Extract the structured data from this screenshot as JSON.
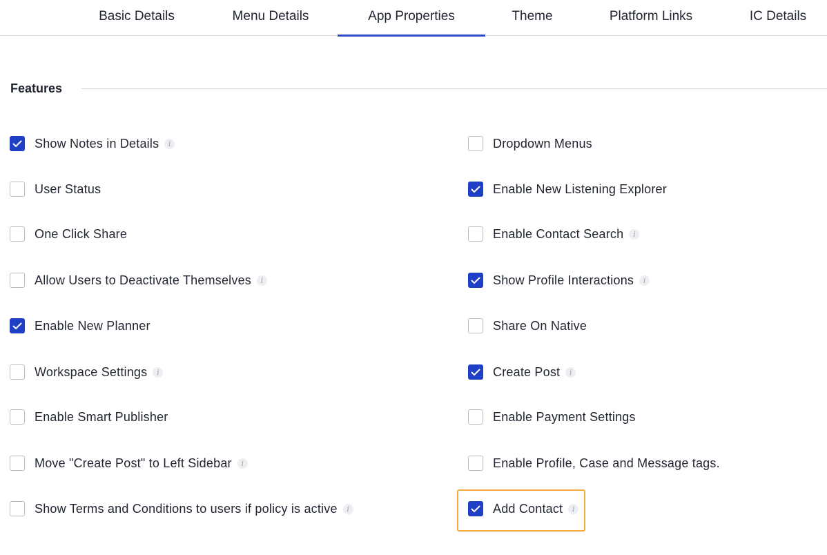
{
  "tabs": [
    {
      "label": "Basic Details",
      "active": false
    },
    {
      "label": "Menu Details",
      "active": false
    },
    {
      "label": "App Properties",
      "active": true
    },
    {
      "label": "Theme",
      "active": false
    },
    {
      "label": "Platform Links",
      "active": false
    },
    {
      "label": "IC Details",
      "active": false
    }
  ],
  "section": {
    "title": "Features"
  },
  "features_left": [
    {
      "label": "Show Notes in Details",
      "checked": true,
      "info": true
    },
    {
      "label": "User Status",
      "checked": false,
      "info": false
    },
    {
      "label": "One Click Share",
      "checked": false,
      "info": false
    },
    {
      "label": "Allow Users to Deactivate Themselves",
      "checked": false,
      "info": true
    },
    {
      "label": "Enable New Planner",
      "checked": true,
      "info": false
    },
    {
      "label": "Workspace Settings",
      "checked": false,
      "info": true
    },
    {
      "label": "Enable Smart Publisher",
      "checked": false,
      "info": false
    },
    {
      "label": "Move \"Create Post\" to Left Sidebar",
      "checked": false,
      "info": true
    },
    {
      "label": "Show Terms and Conditions to users if policy is active",
      "checked": false,
      "info": true
    }
  ],
  "features_right": [
    {
      "label": "Dropdown Menus",
      "checked": false,
      "info": false
    },
    {
      "label": "Enable New Listening Explorer",
      "checked": true,
      "info": false
    },
    {
      "label": "Enable Contact Search",
      "checked": false,
      "info": true
    },
    {
      "label": "Show Profile Interactions",
      "checked": true,
      "info": true
    },
    {
      "label": "Share On Native",
      "checked": false,
      "info": false
    },
    {
      "label": "Create Post",
      "checked": true,
      "info": true
    },
    {
      "label": "Enable Payment Settings",
      "checked": false,
      "info": false
    },
    {
      "label": "Enable Profile, Case and Message tags.",
      "checked": false,
      "info": false
    },
    {
      "label": "Add Contact",
      "checked": true,
      "info": true
    }
  ],
  "info_glyph": "i",
  "colors": {
    "accent": "#1f3fc7",
    "highlight": "#f5a945"
  }
}
